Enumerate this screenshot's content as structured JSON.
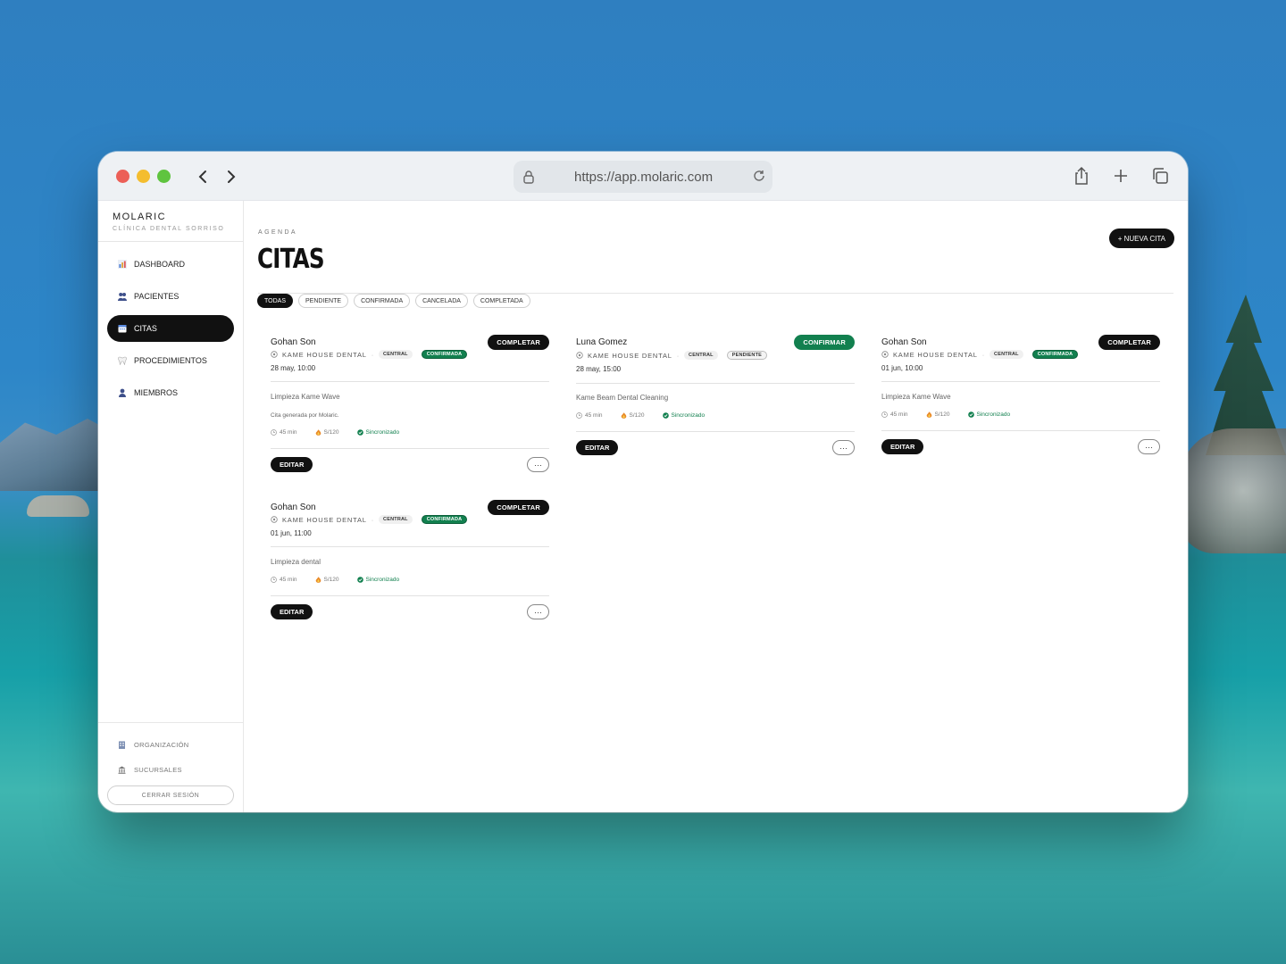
{
  "browser": {
    "url": "https://app.molaric.com"
  },
  "brand": {
    "name": "MOLARIC",
    "subtitle": "CLÍNICA DENTAL SORRISO"
  },
  "sidebar": {
    "items": [
      {
        "label": "DASHBOARD",
        "icon": "chart-icon",
        "active": false
      },
      {
        "label": "PACIENTES",
        "icon": "users-icon",
        "active": false
      },
      {
        "label": "CITAS",
        "icon": "calendar-icon",
        "active": true
      },
      {
        "label": "PROCEDIMIENTOS",
        "icon": "tooth-icon",
        "active": false
      },
      {
        "label": "MIEMBROS",
        "icon": "user-icon",
        "active": false
      }
    ],
    "bottom": [
      {
        "label": "ORGANIZACIÓN",
        "icon": "building-icon"
      },
      {
        "label": "SUCURSALES",
        "icon": "bank-icon"
      }
    ],
    "logout_label": "CERRAR SESIÓN"
  },
  "page": {
    "eyebrow": "AGENDA",
    "title": "CITAS",
    "new_button": "+ NUEVA CITA"
  },
  "filters": [
    "TODAS",
    "PENDIENTE",
    "CONFIRMADA",
    "CANCELADA",
    "COMPLETADA"
  ],
  "appointments": [
    {
      "patient": "Gohan Son",
      "clinic": "KAME HOUSE DENTAL",
      "branch": "CENTRAL",
      "status": "CONFIRMADA",
      "date": "28 may, 10:00",
      "procedure": "Limpieza Kame Wave",
      "note": "Cita generada por Molaric.",
      "duration": "45 min",
      "price": "S/120",
      "sync": "Sincronizado",
      "action": "COMPLETAR",
      "edit": "EDITAR",
      "more": "···"
    },
    {
      "patient": "Luna Gomez",
      "clinic": "KAME HOUSE DENTAL",
      "branch": "CENTRAL",
      "status": "PENDIENTE",
      "date": "28 may, 15:00",
      "procedure": "Kame Beam Dental Cleaning",
      "duration": "45 min",
      "price": "S/120",
      "sync": "Sincronizado",
      "action": "CONFIRMAR",
      "edit": "EDITAR",
      "more": "···"
    },
    {
      "patient": "Gohan Son",
      "clinic": "KAME HOUSE DENTAL",
      "branch": "CENTRAL",
      "status": "CONFIRMADA",
      "date": "01 jun, 10:00",
      "procedure": "Limpieza Kame Wave",
      "duration": "45 min",
      "price": "S/120",
      "sync": "Sincronizado",
      "action": "COMPLETAR",
      "edit": "EDITAR",
      "more": "···"
    },
    {
      "patient": "Gohan Son",
      "clinic": "KAME HOUSE DENTAL",
      "branch": "CENTRAL",
      "status": "CONFIRMADA",
      "date": "01 jun, 11:00",
      "procedure": "Limpieza dental",
      "duration": "45 min",
      "price": "S/120",
      "sync": "Sincronizado",
      "action": "COMPLETAR",
      "edit": "EDITAR",
      "more": "···"
    }
  ],
  "colors": {
    "accent_green": "#12804f",
    "primary_dark": "#111111"
  }
}
